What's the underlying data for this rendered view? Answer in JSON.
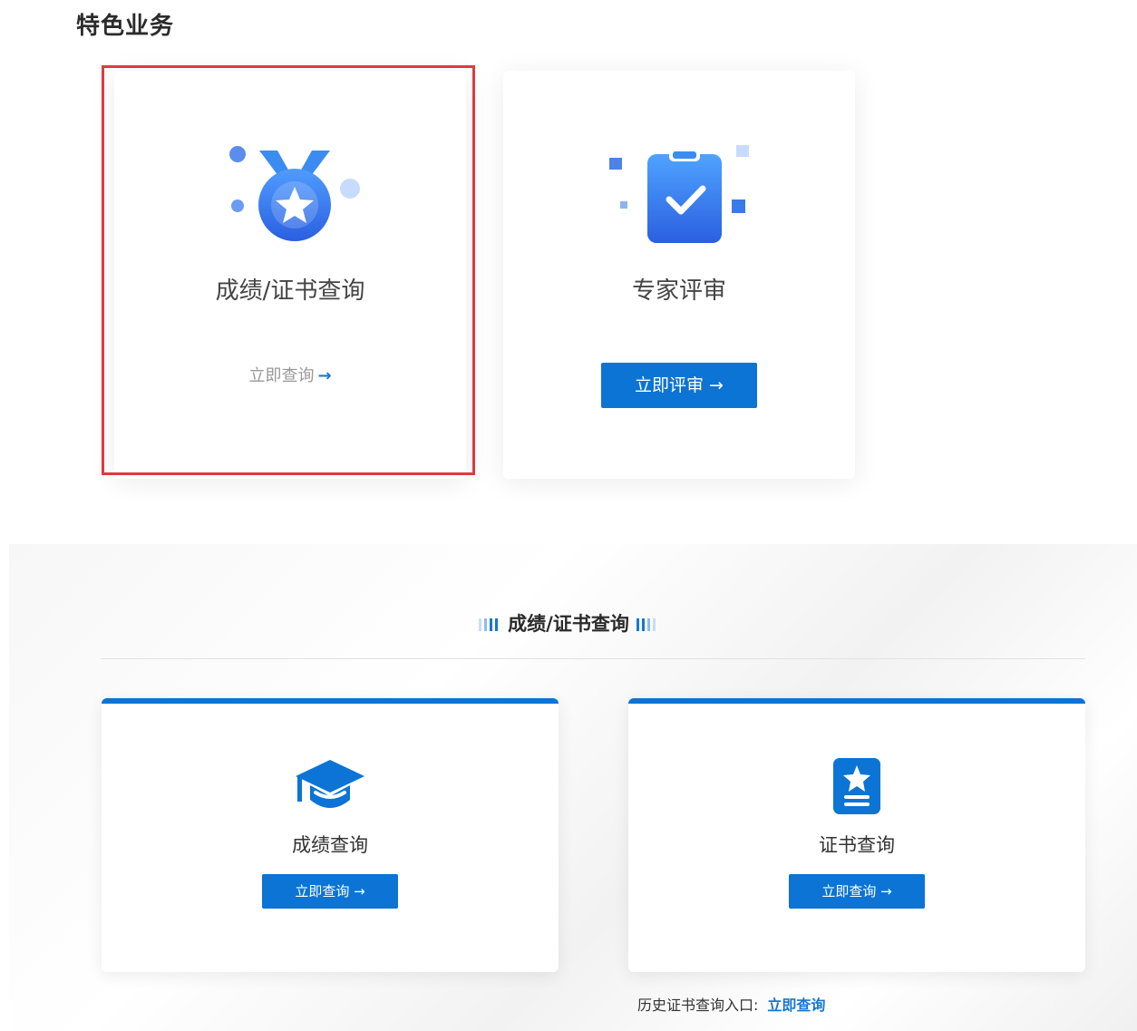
{
  "section": {
    "title": "特色业务"
  },
  "features": [
    {
      "title": "成绩/证书查询",
      "link_label": "立即查询",
      "arrow": "→"
    },
    {
      "title": "专家评审",
      "button_label": "立即评审 →"
    }
  ],
  "lower": {
    "title": "成绩/证书查询",
    "cards": [
      {
        "title": "成绩查询",
        "button_label": "立即查询 →"
      },
      {
        "title": "证书查询",
        "button_label": "立即查询 →"
      }
    ],
    "history_label": "历史证书查询入口:",
    "history_link": "立即查询"
  },
  "colors": {
    "brand_blue": "#0b74d4",
    "highlight_red": "#e03a3e"
  },
  "icons": {
    "feature_1": "medal-star-icon",
    "feature_2": "clipboard-check-icon",
    "card_1": "graduation-cap-icon",
    "card_2": "certificate-icon"
  }
}
